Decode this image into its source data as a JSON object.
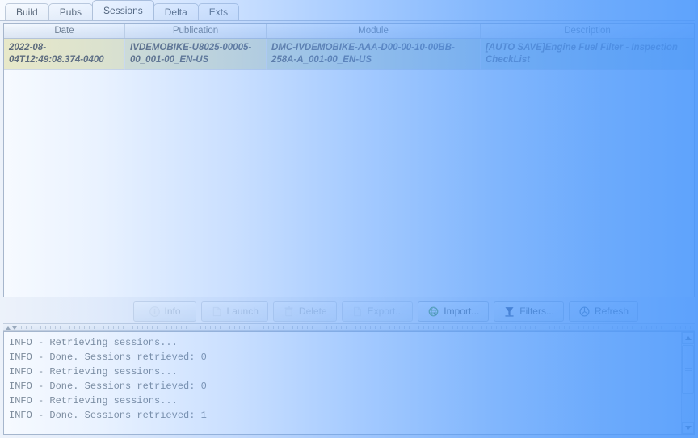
{
  "window": {
    "title": "Sessions"
  },
  "tabs": [
    {
      "label": "Build",
      "active": false
    },
    {
      "label": "Pubs",
      "active": false
    },
    {
      "label": "Sessions",
      "active": true
    },
    {
      "label": "Delta",
      "active": false
    },
    {
      "label": "Exts",
      "active": false
    }
  ],
  "table": {
    "columns": [
      {
        "label": "Date"
      },
      {
        "label": "Publication"
      },
      {
        "label": "Module"
      },
      {
        "label": "Description"
      }
    ],
    "rows": [
      {
        "selected": true,
        "date": "2022-08-04T12:49:08.374-0400",
        "publication": "IVDEMOBIKE-U8025-00005-00_001-00_EN-US",
        "module": "DMC-IVDEMOBIKE-AAA-D00-00-10-00BB-258A-A_001-00_EN-US",
        "description": "[AUTO SAVE]Engine Fuel Filter - Inspection CheckList"
      }
    ]
  },
  "buttons": [
    {
      "label": "Info",
      "icon": "info-icon",
      "enabled": false
    },
    {
      "label": "Launch",
      "icon": "launch-icon",
      "enabled": false
    },
    {
      "label": "Delete",
      "icon": "trash-icon",
      "enabled": false
    },
    {
      "label": "Export...",
      "icon": "export-icon",
      "enabled": false
    },
    {
      "label": "Import...",
      "icon": "import-icon",
      "enabled": true
    },
    {
      "label": "Filters...",
      "icon": "funnel-icon",
      "enabled": true
    },
    {
      "label": "Refresh",
      "icon": "refresh-icon",
      "enabled": true
    }
  ],
  "log": {
    "lines": [
      "INFO - Retrieving sessions...",
      "INFO - Done. Sessions retrieved: 0",
      "INFO - Retrieving sessions...",
      "INFO - Done. Sessions retrieved: 0",
      "INFO - Retrieving sessions...",
      "INFO - Done. Sessions retrieved: 1"
    ]
  },
  "scrollbar": {
    "up_icon": "scroll-up-arrow-icon",
    "down_icon": "scroll-down-arrow-icon"
  },
  "colors": {
    "overlay_blue": "#529bfc",
    "selected_row_date": "#efecc5",
    "selected_row_desc": "#c7dcdc",
    "panel_border": "#a9b7c9",
    "import_icon_green": "#5aa050",
    "funnel_icon_navy": "#2c3f6b"
  }
}
